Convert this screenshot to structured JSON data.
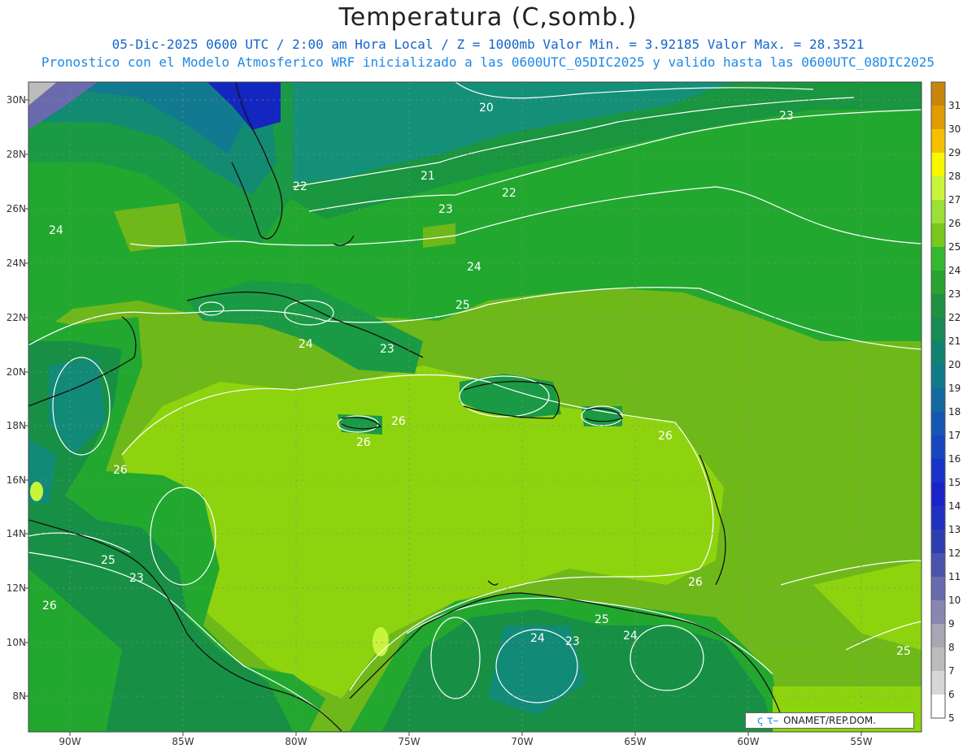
{
  "title": "Temperatura (C,somb.)",
  "subtitle_line1": "05-Dic-2025  0600 UTC / 2:00 am Hora Local / Z = 1000mb   Valor Min. = 3.92185  Valor Max. = 28.3521",
  "subtitle_line2": "Pronostico con el Modelo Atmosferico WRF inicializado a las 0600UTC_05DIC2025 y valido hasta las  0600UTC_08DIC2025",
  "logo_text": "ONAMET/REP.DOM.",
  "lat_labels": [
    "30N",
    "28N",
    "26N",
    "24N",
    "22N",
    "20N",
    "18N",
    "16N",
    "14N",
    "12N",
    "10N",
    "8N"
  ],
  "lon_labels": [
    "90W",
    "85W",
    "80W",
    "75W",
    "70W",
    "65W",
    "60W",
    "55W"
  ],
  "colorbar": {
    "labels": [
      "31",
      "30",
      "29",
      "28",
      "27",
      "26",
      "25",
      "24",
      "23",
      "22",
      "21",
      "20",
      "19",
      "18",
      "17",
      "16",
      "15",
      "14",
      "13",
      "12",
      "11",
      "10",
      "9",
      "8",
      "7",
      "6",
      "5"
    ],
    "colors": [
      "#c8860a",
      "#e09b00",
      "#f6c000",
      "#f7f700",
      "#c8f53c",
      "#9be036",
      "#79c81e",
      "#34b830",
      "#2aa232",
      "#1f9140",
      "#188a55",
      "#138170",
      "#107a88",
      "#126aa0",
      "#1558b3",
      "#1746c0",
      "#1834c8",
      "#1a22c8",
      "#2030c0",
      "#2c3eb0",
      "#4a54ac",
      "#6a6aae",
      "#8a86b2",
      "#a8a6b2",
      "#bcbcbc",
      "#d6d6d6",
      "#ffffff"
    ]
  },
  "contour_labels": [
    "20",
    "23",
    "21",
    "22",
    "22",
    "23",
    "24",
    "24",
    "25",
    "24",
    "23",
    "26",
    "26",
    "26",
    "26",
    "25",
    "23",
    "26",
    "24",
    "23",
    "24",
    "25",
    "26",
    "25"
  ],
  "colors": {
    "grass_light": "#8ed40e",
    "grass_mid": "#6fb81a",
    "green": "#22a82f",
    "green_dark": "#179045",
    "teal": "#128a78",
    "blue_deep": "#1426c0"
  }
}
